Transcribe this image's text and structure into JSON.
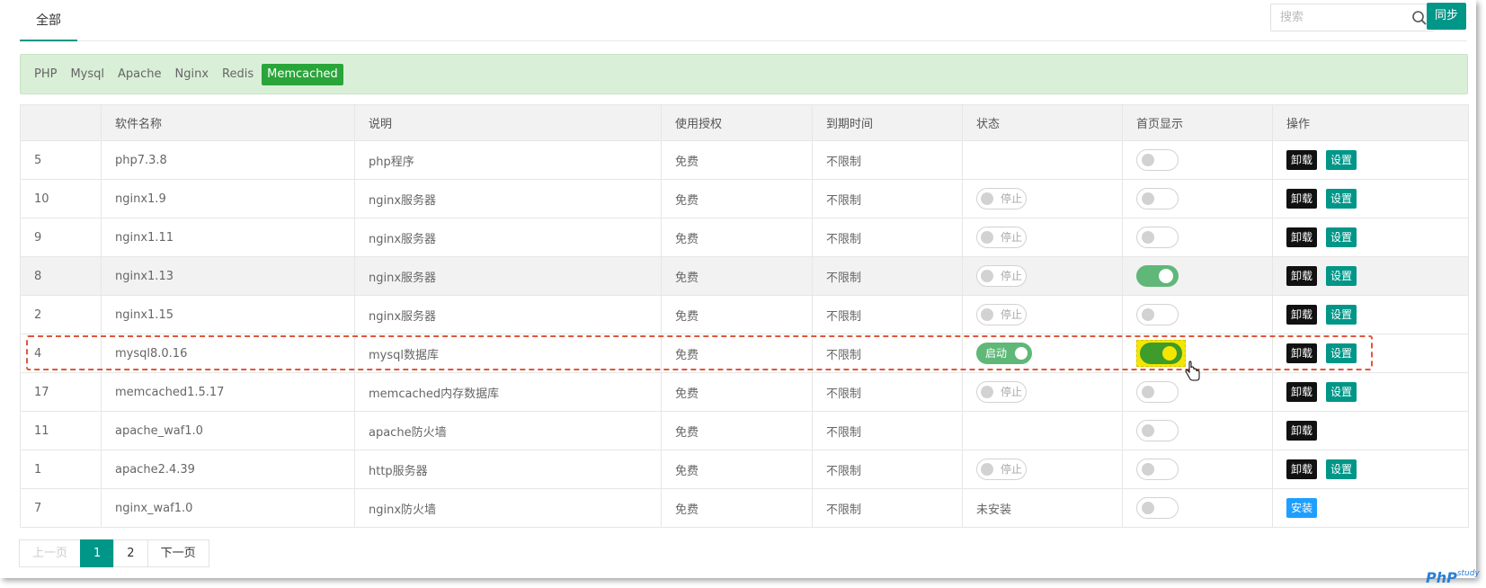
{
  "header": {
    "tab_all": "全部",
    "search_placeholder": "搜索",
    "sync_label": "同步"
  },
  "filters": [
    {
      "label": "PHP",
      "active": false
    },
    {
      "label": "Mysql",
      "active": false
    },
    {
      "label": "Apache",
      "active": false
    },
    {
      "label": "Nginx",
      "active": false
    },
    {
      "label": "Redis",
      "active": false
    },
    {
      "label": "Memcached",
      "active": true
    }
  ],
  "table": {
    "columns": [
      "",
      "软件名称",
      "说明",
      "使用授权",
      "到期时间",
      "状态",
      "首页显示",
      "操作"
    ],
    "rows": [
      {
        "id": "5",
        "name": "php7.3.8",
        "desc": "php程序",
        "license": "免费",
        "expire": "不限制",
        "status": "",
        "home": false,
        "actions": [
          "卸载",
          "设置"
        ]
      },
      {
        "id": "10",
        "name": "nginx1.9",
        "desc": "nginx服务器",
        "license": "免费",
        "expire": "不限制",
        "status": "停止",
        "home": false,
        "actions": [
          "卸载",
          "设置"
        ]
      },
      {
        "id": "9",
        "name": "nginx1.11",
        "desc": "nginx服务器",
        "license": "免费",
        "expire": "不限制",
        "status": "停止",
        "home": false,
        "actions": [
          "卸载",
          "设置"
        ]
      },
      {
        "id": "8",
        "name": "nginx1.13",
        "desc": "nginx服务器",
        "license": "免费",
        "expire": "不限制",
        "status": "停止",
        "home": true,
        "actions": [
          "卸载",
          "设置"
        ]
      },
      {
        "id": "2",
        "name": "nginx1.15",
        "desc": "nginx服务器",
        "license": "免费",
        "expire": "不限制",
        "status": "停止",
        "home": false,
        "actions": [
          "卸载",
          "设置"
        ]
      },
      {
        "id": "4",
        "name": "mysql8.0.16",
        "desc": "mysql数据库",
        "license": "免费",
        "expire": "不限制",
        "status": "启动",
        "home": true,
        "actions": [
          "卸载",
          "设置"
        ]
      },
      {
        "id": "17",
        "name": "memcached1.5.17",
        "desc": "memcached内存数据库",
        "license": "免费",
        "expire": "不限制",
        "status": "停止",
        "home": false,
        "actions": [
          "卸载",
          "设置"
        ]
      },
      {
        "id": "11",
        "name": "apache_waf1.0",
        "desc": "apache防火墙",
        "license": "免费",
        "expire": "不限制",
        "status": "",
        "home": false,
        "actions": [
          "卸载"
        ]
      },
      {
        "id": "1",
        "name": "apache2.4.39",
        "desc": "http服务器",
        "license": "免费",
        "expire": "不限制",
        "status": "停止",
        "home": false,
        "actions": [
          "卸载",
          "设置"
        ]
      },
      {
        "id": "7",
        "name": "nginx_waf1.0",
        "desc": "nginx防火墙",
        "license": "免费",
        "expire": "不限制",
        "status": "未安装",
        "home": false,
        "actions": [
          "安装"
        ]
      }
    ]
  },
  "pager": {
    "prev": "上一页",
    "pages": [
      "1",
      "2"
    ],
    "current": "1",
    "next": "下一页"
  },
  "watermark": {
    "main": "PhP",
    "sub": "study"
  },
  "colors": {
    "accent": "#009688",
    "filter_active": "#2aa53a",
    "filter_bg": "#d9efd7",
    "toggle_on": "#5fb878",
    "highlight_border": "#e0563c",
    "highlight_fill": "#f5e600",
    "install_blue": "#1e9fff"
  }
}
